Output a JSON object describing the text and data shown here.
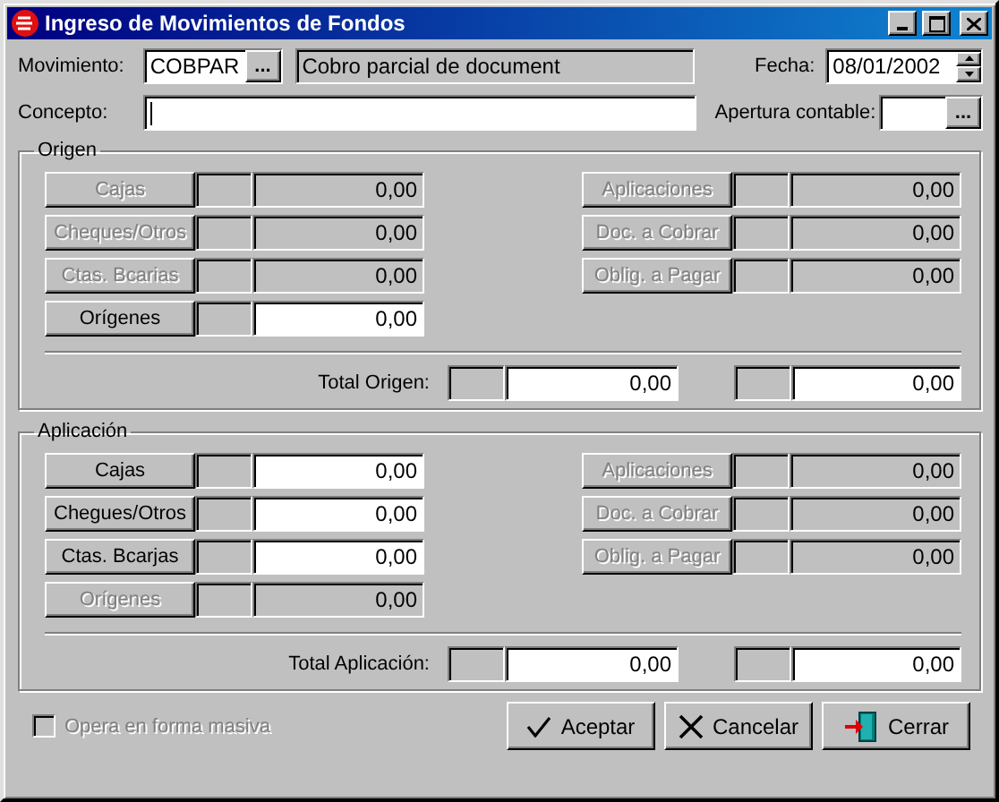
{
  "window": {
    "title": "Ingreso de Movimientos de Fondos"
  },
  "movimiento": {
    "label": "Movimiento:",
    "value": "COBPAR",
    "browse": "...",
    "description": "Cobro parcial de document"
  },
  "fecha": {
    "label": "Fecha:",
    "value": "08/01/2002"
  },
  "concepto": {
    "label": "Concepto:"
  },
  "apertura": {
    "label": "Apertura contable:",
    "browse": "..."
  },
  "sections": [
    {
      "title": "Origen",
      "left_rows": [
        {
          "label": "Cajas",
          "disabled": true,
          "value": "0,00",
          "editable": false
        },
        {
          "label": "Cheques/Otros",
          "disabled": true,
          "value": "0,00",
          "editable": false
        },
        {
          "label": "Ctas. Bcarias",
          "disabled": true,
          "value": "0,00",
          "editable": false
        },
        {
          "label": "Orígenes",
          "disabled": false,
          "value": "0,00",
          "editable": true
        }
      ],
      "right_rows": [
        {
          "label": "Aplicaciones",
          "disabled": true,
          "value": "0,00",
          "editable": false
        },
        {
          "label": "Doc. a Cobrar",
          "disabled": true,
          "value": "0,00",
          "editable": false
        },
        {
          "label": "Oblig. a Pagar",
          "disabled": true,
          "value": "0,00",
          "editable": false
        }
      ],
      "total": {
        "label": "Total Origen:",
        "values": [
          "0,00",
          "0,00"
        ]
      }
    },
    {
      "title": "Aplicación",
      "left_rows": [
        {
          "label": "Cajas",
          "disabled": false,
          "value": "0,00",
          "editable": true
        },
        {
          "label": "Chegues/Otros",
          "disabled": false,
          "value": "0,00",
          "editable": true
        },
        {
          "label": "Ctas. Bcarjas",
          "disabled": false,
          "value": "0,00",
          "editable": true
        },
        {
          "label": "Orígenes",
          "disabled": true,
          "value": "0,00",
          "editable": false
        }
      ],
      "right_rows": [
        {
          "label": "Aplicaciones",
          "disabled": true,
          "value": "0,00",
          "editable": false
        },
        {
          "label": "Doc. a Cobrar",
          "disabled": true,
          "value": "0,00",
          "editable": false
        },
        {
          "label": "Oblig. a Pagar",
          "disabled": true,
          "value": "0,00",
          "editable": false
        }
      ],
      "total": {
        "label": "Total Aplicación:",
        "values": [
          "0,00",
          "0,00"
        ]
      }
    }
  ],
  "masiva": {
    "label": "Opera en forma masiva",
    "checked": false,
    "disabled": true
  },
  "buttons": [
    {
      "kind": "accept",
      "label": "Aceptar"
    },
    {
      "kind": "cancel",
      "label": "Cancelar"
    },
    {
      "kind": "close",
      "label": "Cerrar"
    }
  ]
}
